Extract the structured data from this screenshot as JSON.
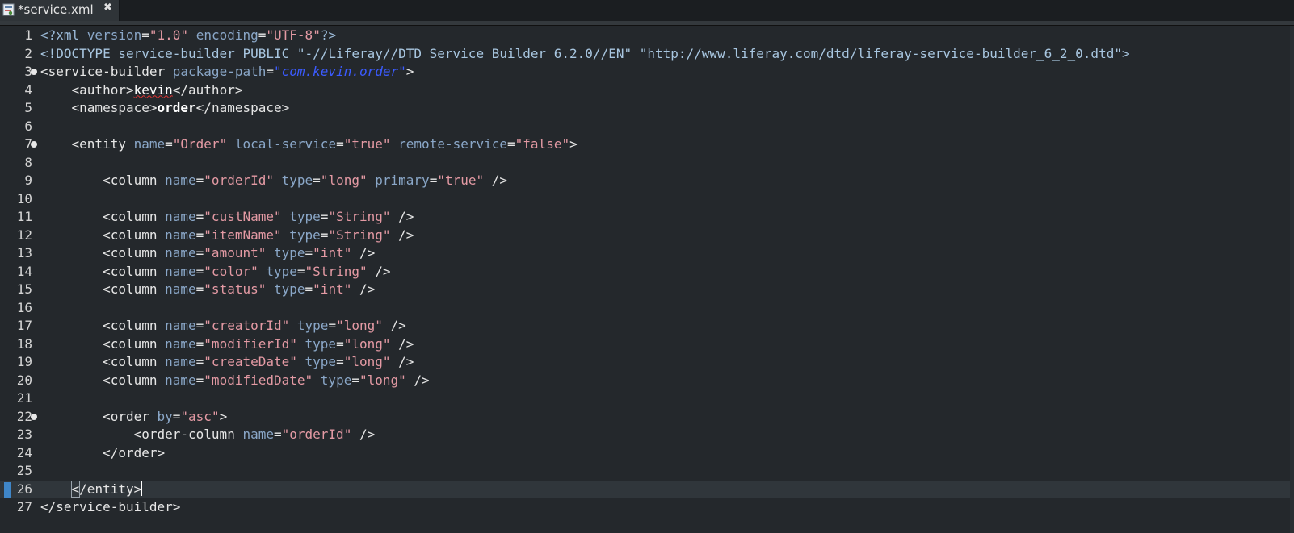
{
  "tab": {
    "title": "*service.xml",
    "close_glyph": "✖",
    "icon": "xml-file-icon"
  },
  "editor": {
    "language": "xml",
    "current_line": 26,
    "lines": [
      {
        "n": "1",
        "tokens": [
          [
            "pi",
            "<?xml "
          ],
          [
            "attr",
            "version"
          ],
          [
            "tag",
            "="
          ],
          [
            "val",
            "\"1.0\""
          ],
          [
            "tag",
            " "
          ],
          [
            "attr",
            "encoding"
          ],
          [
            "tag",
            "="
          ],
          [
            "val",
            "\"UTF-8\""
          ],
          [
            "pi",
            "?>"
          ]
        ]
      },
      {
        "n": "2",
        "tokens": [
          [
            "doc",
            "<!DOCTYPE service-builder PUBLIC \"-//Liferay//DTD Service Builder 6.2.0//EN\" \"http://www.liferay.com/dtd/liferay-service-builder_6_2_0.dtd\">"
          ]
        ]
      },
      {
        "n": "3",
        "fold": true,
        "tokens": [
          [
            "tag",
            "<service-builder "
          ],
          [
            "attr",
            "package-path"
          ],
          [
            "tag",
            "="
          ],
          [
            "valb",
            "\"com.kevin.order\""
          ],
          [
            "tag",
            ">"
          ]
        ]
      },
      {
        "n": "4",
        "tokens": [
          [
            "tag",
            "    <author>"
          ],
          [
            "sq",
            "kevin"
          ],
          [
            "tag",
            "</author>"
          ]
        ]
      },
      {
        "n": "5",
        "tokens": [
          [
            "tag",
            "    <namespace>"
          ],
          [
            "bold",
            "order"
          ],
          [
            "tag",
            "</namespace>"
          ]
        ]
      },
      {
        "n": "6",
        "tokens": []
      },
      {
        "n": "7",
        "fold": true,
        "tokens": [
          [
            "tag",
            "    <entity "
          ],
          [
            "attr",
            "name"
          ],
          [
            "tag",
            "="
          ],
          [
            "val",
            "\"Order\""
          ],
          [
            "tag",
            " "
          ],
          [
            "attr",
            "local-service"
          ],
          [
            "tag",
            "="
          ],
          [
            "val",
            "\"true\""
          ],
          [
            "tag",
            " "
          ],
          [
            "attr",
            "remote-service"
          ],
          [
            "tag",
            "="
          ],
          [
            "val",
            "\"false\""
          ],
          [
            "tag",
            ">"
          ]
        ]
      },
      {
        "n": "8",
        "tokens": []
      },
      {
        "n": "9",
        "tokens": [
          [
            "tag",
            "        <column "
          ],
          [
            "attr",
            "name"
          ],
          [
            "tag",
            "="
          ],
          [
            "val",
            "\"orderId\""
          ],
          [
            "tag",
            " "
          ],
          [
            "attr",
            "type"
          ],
          [
            "tag",
            "="
          ],
          [
            "val",
            "\"long\""
          ],
          [
            "tag",
            " "
          ],
          [
            "attr",
            "primary"
          ],
          [
            "tag",
            "="
          ],
          [
            "val",
            "\"true\""
          ],
          [
            "tag",
            " />"
          ]
        ]
      },
      {
        "n": "10",
        "tokens": []
      },
      {
        "n": "11",
        "tokens": [
          [
            "tag",
            "        <column "
          ],
          [
            "attr",
            "name"
          ],
          [
            "tag",
            "="
          ],
          [
            "val",
            "\"custName\""
          ],
          [
            "tag",
            " "
          ],
          [
            "attr",
            "type"
          ],
          [
            "tag",
            "="
          ],
          [
            "val",
            "\"String\""
          ],
          [
            "tag",
            " />"
          ]
        ]
      },
      {
        "n": "12",
        "tokens": [
          [
            "tag",
            "        <column "
          ],
          [
            "attr",
            "name"
          ],
          [
            "tag",
            "="
          ],
          [
            "val",
            "\"itemName\""
          ],
          [
            "tag",
            " "
          ],
          [
            "attr",
            "type"
          ],
          [
            "tag",
            "="
          ],
          [
            "val",
            "\"String\""
          ],
          [
            "tag",
            " />"
          ]
        ]
      },
      {
        "n": "13",
        "tokens": [
          [
            "tag",
            "        <column "
          ],
          [
            "attr",
            "name"
          ],
          [
            "tag",
            "="
          ],
          [
            "val",
            "\"amount\""
          ],
          [
            "tag",
            " "
          ],
          [
            "attr",
            "type"
          ],
          [
            "tag",
            "="
          ],
          [
            "val",
            "\"int\""
          ],
          [
            "tag",
            " />"
          ]
        ]
      },
      {
        "n": "14",
        "tokens": [
          [
            "tag",
            "        <column "
          ],
          [
            "attr",
            "name"
          ],
          [
            "tag",
            "="
          ],
          [
            "val",
            "\"color\""
          ],
          [
            "tag",
            " "
          ],
          [
            "attr",
            "type"
          ],
          [
            "tag",
            "="
          ],
          [
            "val",
            "\"String\""
          ],
          [
            "tag",
            " />"
          ]
        ]
      },
      {
        "n": "15",
        "tokens": [
          [
            "tag",
            "        <column "
          ],
          [
            "attr",
            "name"
          ],
          [
            "tag",
            "="
          ],
          [
            "val",
            "\"status\""
          ],
          [
            "tag",
            " "
          ],
          [
            "attr",
            "type"
          ],
          [
            "tag",
            "="
          ],
          [
            "val",
            "\"int\""
          ],
          [
            "tag",
            " />"
          ]
        ]
      },
      {
        "n": "16",
        "tokens": []
      },
      {
        "n": "17",
        "tokens": [
          [
            "tag",
            "        <column "
          ],
          [
            "attr",
            "name"
          ],
          [
            "tag",
            "="
          ],
          [
            "val",
            "\"creatorId\""
          ],
          [
            "tag",
            " "
          ],
          [
            "attr",
            "type"
          ],
          [
            "tag",
            "="
          ],
          [
            "val",
            "\"long\""
          ],
          [
            "tag",
            " />"
          ]
        ]
      },
      {
        "n": "18",
        "tokens": [
          [
            "tag",
            "        <column "
          ],
          [
            "attr",
            "name"
          ],
          [
            "tag",
            "="
          ],
          [
            "val",
            "\"modifierId\""
          ],
          [
            "tag",
            " "
          ],
          [
            "attr",
            "type"
          ],
          [
            "tag",
            "="
          ],
          [
            "val",
            "\"long\""
          ],
          [
            "tag",
            " />"
          ]
        ]
      },
      {
        "n": "19",
        "tokens": [
          [
            "tag",
            "        <column "
          ],
          [
            "attr",
            "name"
          ],
          [
            "tag",
            "="
          ],
          [
            "val",
            "\"createDate\""
          ],
          [
            "tag",
            " "
          ],
          [
            "attr",
            "type"
          ],
          [
            "tag",
            "="
          ],
          [
            "val",
            "\"long\""
          ],
          [
            "tag",
            " />"
          ]
        ]
      },
      {
        "n": "20",
        "tokens": [
          [
            "tag",
            "        <column "
          ],
          [
            "attr",
            "name"
          ],
          [
            "tag",
            "="
          ],
          [
            "val",
            "\"modifiedDate\""
          ],
          [
            "tag",
            " "
          ],
          [
            "attr",
            "type"
          ],
          [
            "tag",
            "="
          ],
          [
            "val",
            "\"long\""
          ],
          [
            "tag",
            " />"
          ]
        ]
      },
      {
        "n": "21",
        "tokens": []
      },
      {
        "n": "22",
        "fold": true,
        "tokens": [
          [
            "tag",
            "        <order "
          ],
          [
            "attr",
            "by"
          ],
          [
            "tag",
            "="
          ],
          [
            "val",
            "\"asc\""
          ],
          [
            "tag",
            ">"
          ]
        ]
      },
      {
        "n": "23",
        "tokens": [
          [
            "tag",
            "            <order-column "
          ],
          [
            "attr",
            "name"
          ],
          [
            "tag",
            "="
          ],
          [
            "val",
            "\"orderId\""
          ],
          [
            "tag",
            " />"
          ]
        ]
      },
      {
        "n": "24",
        "tokens": [
          [
            "tag",
            "        </order>"
          ]
        ]
      },
      {
        "n": "25",
        "tokens": []
      },
      {
        "n": "26",
        "current": true,
        "tokens": [
          [
            "tag",
            "    "
          ],
          [
            "match",
            "<"
          ],
          [
            "tag",
            "/entity>"
          ],
          [
            "cursor",
            ""
          ]
        ]
      },
      {
        "n": "27",
        "tokens": [
          [
            "tag",
            "</service-builder>"
          ]
        ]
      }
    ]
  }
}
